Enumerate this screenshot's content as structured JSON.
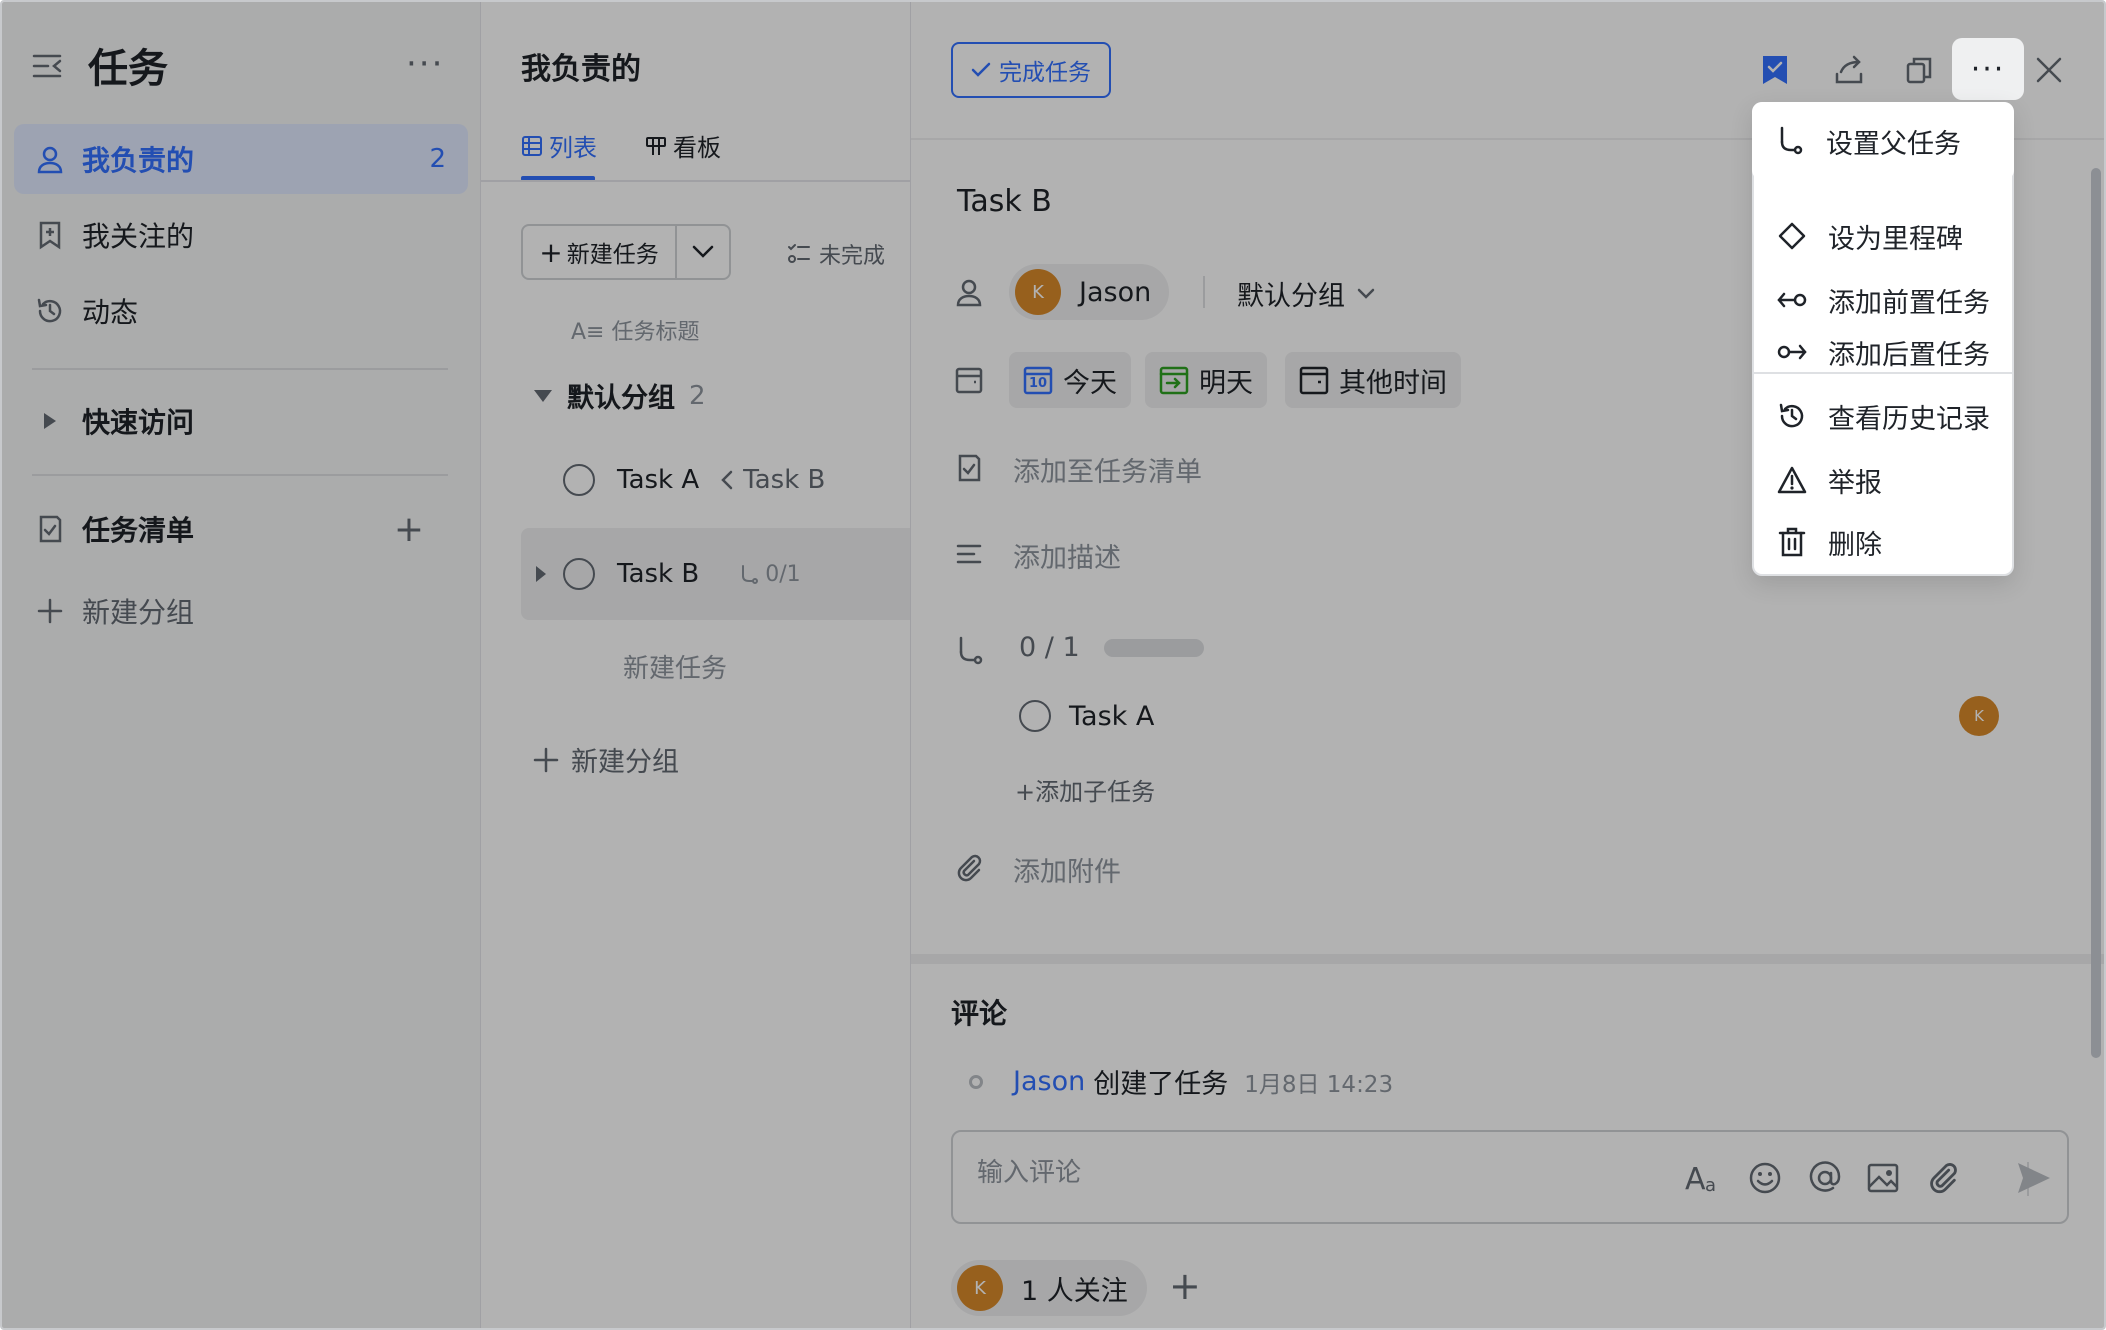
{
  "sidebar": {
    "title": "任务",
    "items": [
      {
        "label": "我负责的",
        "count": "2"
      },
      {
        "label": "我关注的"
      },
      {
        "label": "动态"
      }
    ],
    "quick_access": "快速访问",
    "task_lists": "任务清单",
    "new_group": "新建分组"
  },
  "list": {
    "title": "我负责的",
    "tabs": [
      {
        "label": "列表"
      },
      {
        "label": "看板"
      }
    ],
    "new_task_button": "新建任务",
    "filter": "未完成",
    "column_header": "任务标题",
    "group": {
      "name": "默认分组",
      "count": "2"
    },
    "rows": [
      {
        "task": "Task A",
        "parent": "Task B"
      },
      {
        "task": "Task B",
        "subtasks": "0/1"
      }
    ],
    "new_task_placeholder": "新建任务",
    "new_group": "新建分组"
  },
  "detail": {
    "complete_button": "完成任务",
    "title": "Task B",
    "assignee": {
      "name": "Jason",
      "initial": "K"
    },
    "group": "默认分组",
    "dates": {
      "today": "今天",
      "tomorrow": "明天",
      "other": "其他时间",
      "today_day": "10"
    },
    "add_to_list": "添加至任务清单",
    "add_description": "添加描述",
    "subtask_progress": "0 / 1",
    "subtask_progress_fraction": 0,
    "subtask": {
      "name": "Task A",
      "initial": "K"
    },
    "add_subtask": "添加子任务",
    "add_attachment": "添加附件",
    "comments_title": "评论",
    "activity": {
      "who": "Jason",
      "action": "创建了任务",
      "time": "1月8日 14:23"
    },
    "comment_placeholder": "输入评论",
    "followers": {
      "text": "1 人关注",
      "initial": "K"
    }
  },
  "menu": {
    "items": [
      {
        "label": "设置父任务"
      },
      {
        "label": "设为里程碑"
      },
      {
        "label": "添加前置任务"
      },
      {
        "label": "添加后置任务"
      },
      {
        "label": "查看历史记录"
      },
      {
        "label": "举报"
      },
      {
        "label": "删除"
      }
    ]
  },
  "colors": {
    "accent": "#3370ff",
    "avatar": "#d98a2a",
    "overlay": "rgba(0,0,0,0.30)"
  }
}
